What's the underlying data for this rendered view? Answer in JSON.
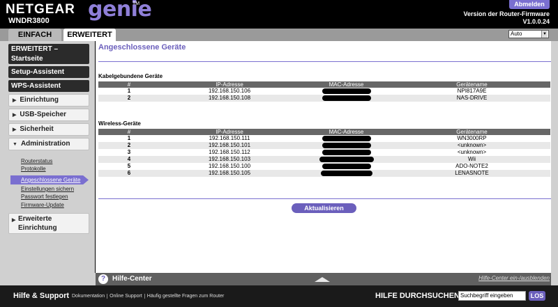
{
  "header": {
    "brand": "NETGEAR",
    "product": "genie",
    "trademark": "TM",
    "model": "WNDR3800",
    "logout_label": "Abmelden",
    "firmware_label": "Version der Router-Firmware",
    "firmware_version": "V1.0.0.24",
    "tabs": [
      {
        "label": "EINFACH",
        "active": false
      },
      {
        "label": "ERWEITERT",
        "active": true
      }
    ],
    "language_selected": "Auto"
  },
  "sidebar": {
    "home_label_1": "ERWEITERT –",
    "home_label_2": "Startseite",
    "setup_label": "Setup-Assistent",
    "wps_label": "WPS-Assistent",
    "items": [
      {
        "label": "Einrichtung",
        "expanded": false
      },
      {
        "label": "USB-Speicher",
        "expanded": false
      },
      {
        "label": "Sicherheit",
        "expanded": false
      },
      {
        "label": "Administration",
        "expanded": true
      }
    ],
    "admin_links": [
      {
        "label": "Routerstatus",
        "active": false
      },
      {
        "label": "Protokolle",
        "active": false
      },
      {
        "label": "Angeschlossene Geräte",
        "active": true
      },
      {
        "label": "Einstellungen sichern",
        "active": false
      },
      {
        "label": "Passwort festlegen",
        "active": false
      },
      {
        "label": "Firmware-Update",
        "active": false
      }
    ],
    "advanced_label_1": "Erweiterte",
    "advanced_label_2": "Einrichtung"
  },
  "main": {
    "title": "Angeschlossene Geräte",
    "wired": {
      "title": "Kabelgebundene Geräte",
      "headers": [
        "#",
        "IP-Adresse",
        "MAC-Adresse",
        "Gerätename"
      ],
      "rows": [
        {
          "num": "1",
          "ip": "192.168.150.106",
          "name": "NPI817A9E"
        },
        {
          "num": "2",
          "ip": "192.168.150.108",
          "name": "NAS-DRIVE"
        }
      ]
    },
    "wireless": {
      "title": "Wireless-Geräte",
      "headers": [
        "#",
        "IP-Adresse",
        "MAC-Adresse",
        "Gerätename"
      ],
      "rows": [
        {
          "num": "1",
          "ip": "192.168.150.111",
          "name": "WN3000RP"
        },
        {
          "num": "2",
          "ip": "192.168.150.101",
          "name": "<unknown>"
        },
        {
          "num": "3",
          "ip": "192.168.150.112",
          "name": "<unknown>"
        },
        {
          "num": "4",
          "ip": "192.168.150.103",
          "name": "Wii"
        },
        {
          "num": "5",
          "ip": "192.168.150.100",
          "name": "ADO-NOTE2"
        },
        {
          "num": "6",
          "ip": "192.168.150.105",
          "name": "LENASNOTE"
        }
      ]
    },
    "refresh_label": "Aktualisieren"
  },
  "help": {
    "icon": "question-icon",
    "title": "Hilfe-Center",
    "toggle_label": "Hilfe-Center ein-/ausblenden"
  },
  "footer": {
    "support_label": "Hilfe & Support",
    "links": [
      "Dokumentation",
      "Online Support",
      "Häufig gestellte Fragen zum Router"
    ],
    "search_label": "HILFE DURCHSUCHEN",
    "search_value": "Suchbegriff eingeben",
    "search_button": "LOS"
  },
  "colors": {
    "accent": "#6b5fbc",
    "header_bg": "#000000",
    "table_header": "#676767"
  }
}
